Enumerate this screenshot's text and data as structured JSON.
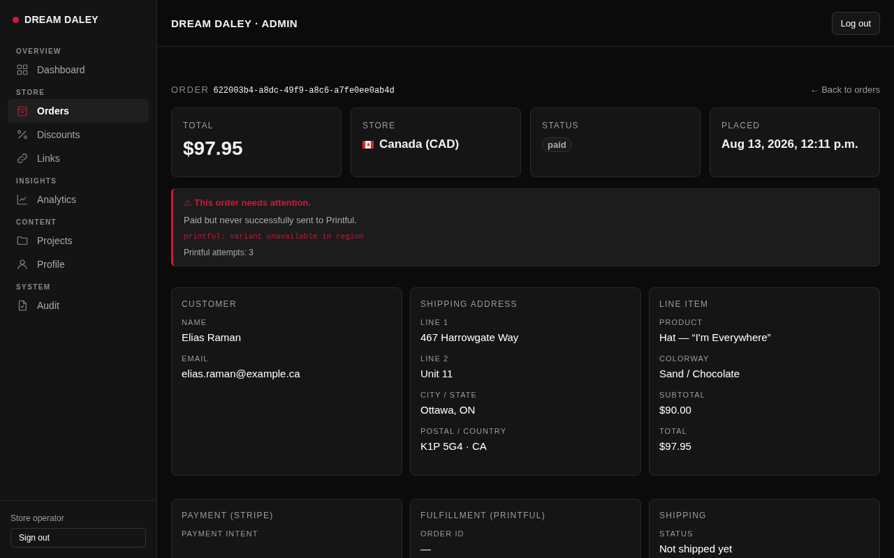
{
  "brand": {
    "name": "DREAM DALEY"
  },
  "sidebar": {
    "sections": [
      {
        "title": "OVERVIEW",
        "items": [
          {
            "label": "Dashboard",
            "kind": "grid",
            "selected": false
          }
        ]
      },
      {
        "title": "STORE",
        "items": [
          {
            "label": "Orders",
            "kind": "bag",
            "selected": true
          },
          {
            "label": "Discounts",
            "kind": "percent",
            "selected": false
          },
          {
            "label": "Links",
            "kind": "link",
            "selected": false
          }
        ]
      },
      {
        "title": "INSIGHTS",
        "items": [
          {
            "label": "Analytics",
            "kind": "chart",
            "selected": false
          }
        ]
      },
      {
        "title": "CONTENT",
        "items": [
          {
            "label": "Projects",
            "kind": "folder",
            "selected": false
          },
          {
            "label": "Profile",
            "kind": "person",
            "selected": false
          }
        ]
      },
      {
        "title": "SYSTEM",
        "items": [
          {
            "label": "Audit",
            "kind": "file",
            "selected": false
          }
        ]
      }
    ],
    "footer": {
      "role": "Store operator",
      "button": "Sign out"
    }
  },
  "header": {
    "title": "DREAM DALEY · ADMIN",
    "button": "Log out"
  },
  "order": {
    "label": "ORDER",
    "id": "622003b4-a8dc-49f9-a8c6-a7fe0ee0ab4d",
    "back_link": "← Back to orders"
  },
  "summary": [
    {
      "kind": "amount",
      "label": "TOTAL",
      "value": "$97.95"
    },
    {
      "kind": "flag",
      "label": "STORE",
      "value": "Canada (CAD)"
    },
    {
      "kind": "badge",
      "label": "STATUS",
      "value": "paid"
    },
    {
      "kind": "text",
      "label": "PLACED",
      "value": "Aug 13, 2026, 12:11 p.m."
    }
  ],
  "alert": {
    "title": "⚠ This order needs attention.",
    "message": "Paid but never successfully sent to Printful.",
    "error": "printful: variant unavailable in region",
    "attempts": "Printful attempts: 3"
  },
  "panels": [
    {
      "title": "CUSTOMER",
      "fields": [
        {
          "label": "NAME",
          "value": "Elias Raman"
        },
        {
          "label": "EMAIL",
          "value": "elias.raman@example.ca"
        }
      ]
    },
    {
      "title": "SHIPPING ADDRESS",
      "fields": [
        {
          "label": "LINE 1",
          "value": "467 Harrowgate Way"
        },
        {
          "label": "LINE 2",
          "value": "Unit 11"
        },
        {
          "label": "CITY / STATE",
          "value": "Ottawa, ON"
        },
        {
          "label": "POSTAL / COUNTRY",
          "value": "K1P 5G4 · CA"
        }
      ]
    },
    {
      "title": "LINE ITEM",
      "fields": [
        {
          "label": "PRODUCT",
          "value": "Hat — “I'm Everywhere”"
        },
        {
          "label": "COLORWAY",
          "value": "Sand / Chocolate"
        },
        {
          "label": "SUBTOTAL",
          "value": "$90.00"
        },
        {
          "label": "TOTAL",
          "value": "$97.95"
        }
      ]
    },
    {
      "title": "PAYMENT (STRIPE)",
      "fields": [
        {
          "label": "PAYMENT INTENT"
        }
      ]
    },
    {
      "title": "FULFILLMENT (PRINTFUL)",
      "fields": [
        {
          "label": "ORDER ID",
          "value": "—"
        }
      ]
    },
    {
      "title": "SHIPPING",
      "fields": [
        {
          "label": "STATUS",
          "value": "Not shipped yet"
        }
      ]
    }
  ]
}
